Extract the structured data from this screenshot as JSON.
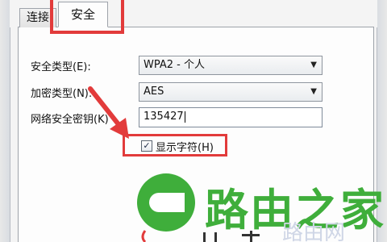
{
  "tabs": [
    {
      "label": "连接"
    },
    {
      "label": "安全"
    }
  ],
  "form": {
    "security_type": {
      "label": "安全类型(E):",
      "value": "WPA2 - 个人"
    },
    "encryption_type": {
      "label": "加密类型(N):",
      "value": "AES"
    },
    "network_key": {
      "label": "网络安全密钥(K)",
      "value": "135427"
    },
    "show_chars": {
      "label": "显示字符(H)",
      "checked": true
    }
  },
  "watermark": {
    "brand": "路由之家",
    "faint": "路由网"
  },
  "colors": {
    "highlight": "#e23b3b",
    "brand_green": "#3fae3b"
  },
  "icons": {
    "dropdown": "chevron-down-icon",
    "checkbox": "checkmark-icon",
    "annotation": "arrow-icon"
  }
}
